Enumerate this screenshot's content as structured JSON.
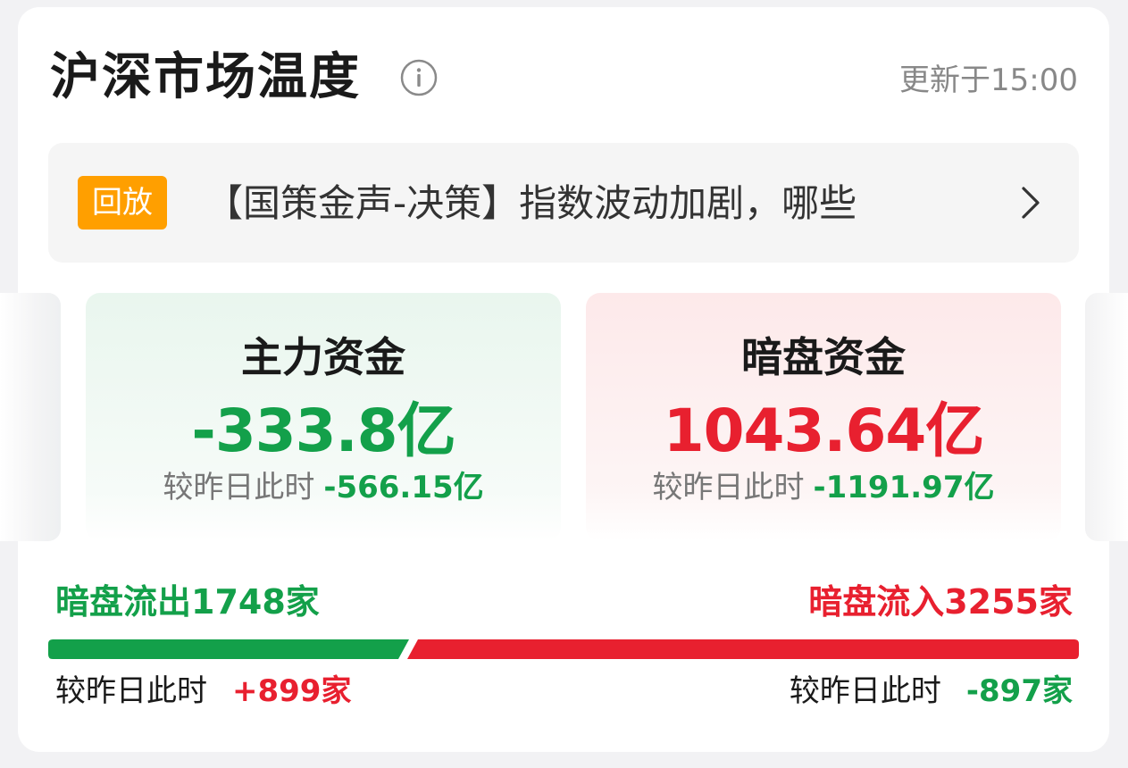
{
  "header": {
    "title": "沪深市场温度",
    "info_icon": "info-icon",
    "updated": "更新于15:00"
  },
  "banner": {
    "badge": "回放",
    "text": "【国策金声-决策】指数波动加剧，哪些",
    "chevron_icon": "chevron-right-icon"
  },
  "cards": [
    {
      "title": "主力资金",
      "value": "-333.8亿",
      "compare_label": "较昨日此时",
      "compare_value": "-566.15亿",
      "accent": "#13a04a"
    },
    {
      "title": "暗盘资金",
      "value": "1043.64亿",
      "compare_label": "较昨日此时",
      "compare_value": "-1191.97亿",
      "accent": "#e8202f"
    }
  ],
  "flow": {
    "outflow_label": "暗盘流出1748家",
    "inflow_label": "暗盘流入3255家",
    "outflow_count": 1748,
    "inflow_count": 3255,
    "outflow_color": "#13a04a",
    "inflow_color": "#e8202f",
    "left_compare_label": "较昨日此时",
    "left_compare_value": "+899家",
    "right_compare_label": "较昨日此时",
    "right_compare_value": "-897家"
  }
}
